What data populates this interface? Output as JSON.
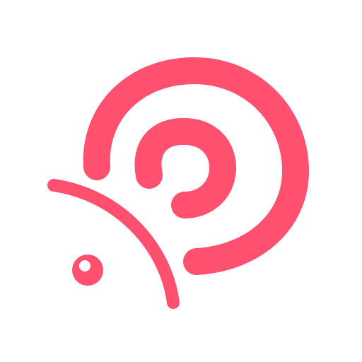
{
  "logo": {
    "icon": "snail-spiral-logo",
    "colors": {
      "primary": "#FF5070",
      "highlight": "#FFFFFF",
      "background": "#FFFFFF"
    }
  }
}
